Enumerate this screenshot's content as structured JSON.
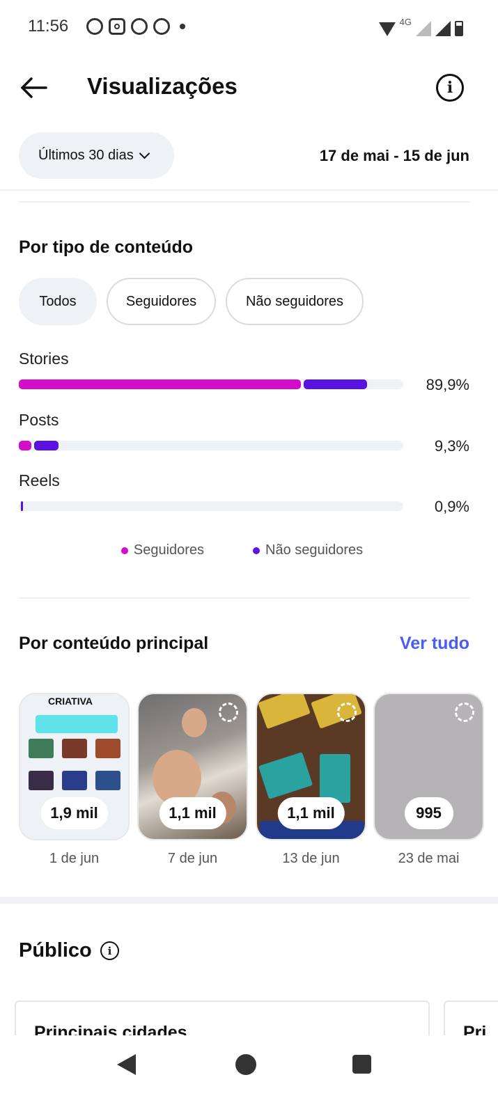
{
  "status_bar": {
    "time": "11:56",
    "app_icons": [
      "whatsapp-icon",
      "instagram-icon",
      "whatsapp-icon",
      "pinterest-icon"
    ],
    "network_label": "4G"
  },
  "header": {
    "title": "Visualizações"
  },
  "filters": {
    "period_label": "Últimos 30 dias",
    "date_range": "17 de mai - 15 de jun"
  },
  "content_type": {
    "title": "Por tipo de conteúdo",
    "chips": [
      {
        "label": "Todos",
        "active": true
      },
      {
        "label": "Seguidores",
        "active": false
      },
      {
        "label": "Não seguidores",
        "active": false
      }
    ],
    "colors": {
      "followers": "#d30ccb",
      "non_followers": "#5a12e1"
    },
    "bars": [
      {
        "label": "Stories",
        "percent": "89,9%",
        "value": 89.9,
        "followers_fraction": 0.734,
        "non_followers_fraction": 0.164
      },
      {
        "label": "Posts",
        "percent": "9,3%",
        "value": 9.3,
        "followers_fraction": 0.033,
        "non_followers_fraction": 0.064
      },
      {
        "label": "Reels",
        "percent": "0,9%",
        "value": 0.9,
        "followers_fraction": 0.0,
        "non_followers_fraction": 0.006
      }
    ],
    "legend": {
      "followers": "Seguidores",
      "non_followers": "Não seguidores"
    }
  },
  "top_content": {
    "title": "Por conteúdo principal",
    "see_all": "Ver tudo",
    "items": [
      {
        "count": "1,9 mil",
        "date": "1 de jun"
      },
      {
        "count": "1,1 mil",
        "date": "7 de jun"
      },
      {
        "count": "1,1 mil",
        "date": "13 de jun"
      },
      {
        "count": "995",
        "date": "23 de mai"
      }
    ],
    "thumb1_text": "CRIATIVA"
  },
  "public": {
    "title": "Público",
    "card_title": "Principais cidades",
    "card2_title": "Pri"
  }
}
